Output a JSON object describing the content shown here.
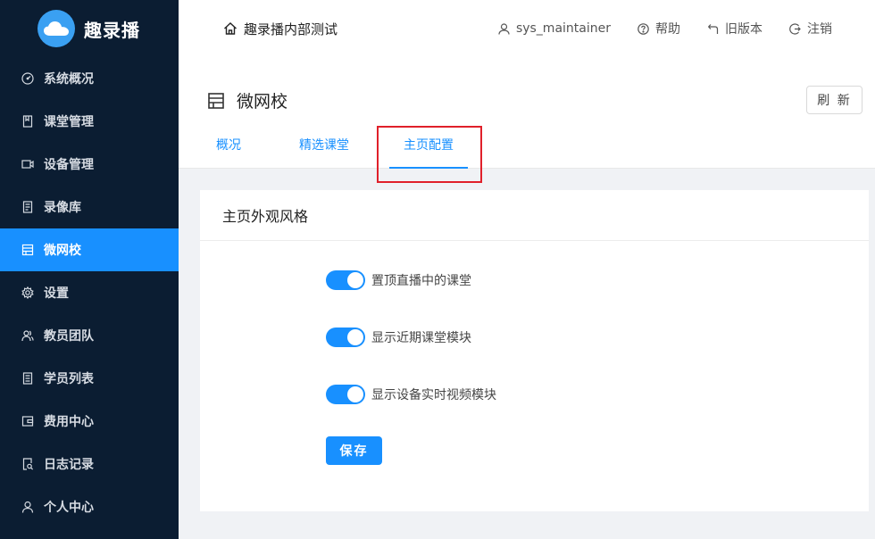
{
  "brand": {
    "name": "趣录播",
    "accent": "#1890ff"
  },
  "sidebar": {
    "items": [
      {
        "label": "系统概况",
        "icon": "dashboard-icon"
      },
      {
        "label": "课堂管理",
        "icon": "book-icon"
      },
      {
        "label": "设备管理",
        "icon": "video-camera-icon"
      },
      {
        "label": "录像库",
        "icon": "file-text-icon"
      },
      {
        "label": "微网校",
        "icon": "shop-icon",
        "active": true
      },
      {
        "label": "设置",
        "icon": "gear-icon"
      },
      {
        "label": "教员团队",
        "icon": "team-icon"
      },
      {
        "label": "学员列表",
        "icon": "list-icon"
      },
      {
        "label": "费用中心",
        "icon": "wallet-icon"
      },
      {
        "label": "日志记录",
        "icon": "file-search-icon"
      },
      {
        "label": "个人中心",
        "icon": "user-icon"
      }
    ]
  },
  "header": {
    "breadcrumb": "趣录播内部测试",
    "user": "sys_maintainer",
    "help": "帮助",
    "old_version": "旧版本",
    "logout": "注销"
  },
  "page": {
    "title": "微网校",
    "refresh_label": "刷 新",
    "tabs": [
      {
        "label": "概况"
      },
      {
        "label": "精选课堂"
      },
      {
        "label": "主页配置",
        "active": true
      }
    ]
  },
  "card": {
    "title": "主页外观风格",
    "toggles": [
      {
        "label": "置顶直播中的课堂",
        "on": true
      },
      {
        "label": "显示近期课堂模块",
        "on": true
      },
      {
        "label": "显示设备实时视频模块",
        "on": true
      }
    ],
    "save_label": "保存"
  }
}
